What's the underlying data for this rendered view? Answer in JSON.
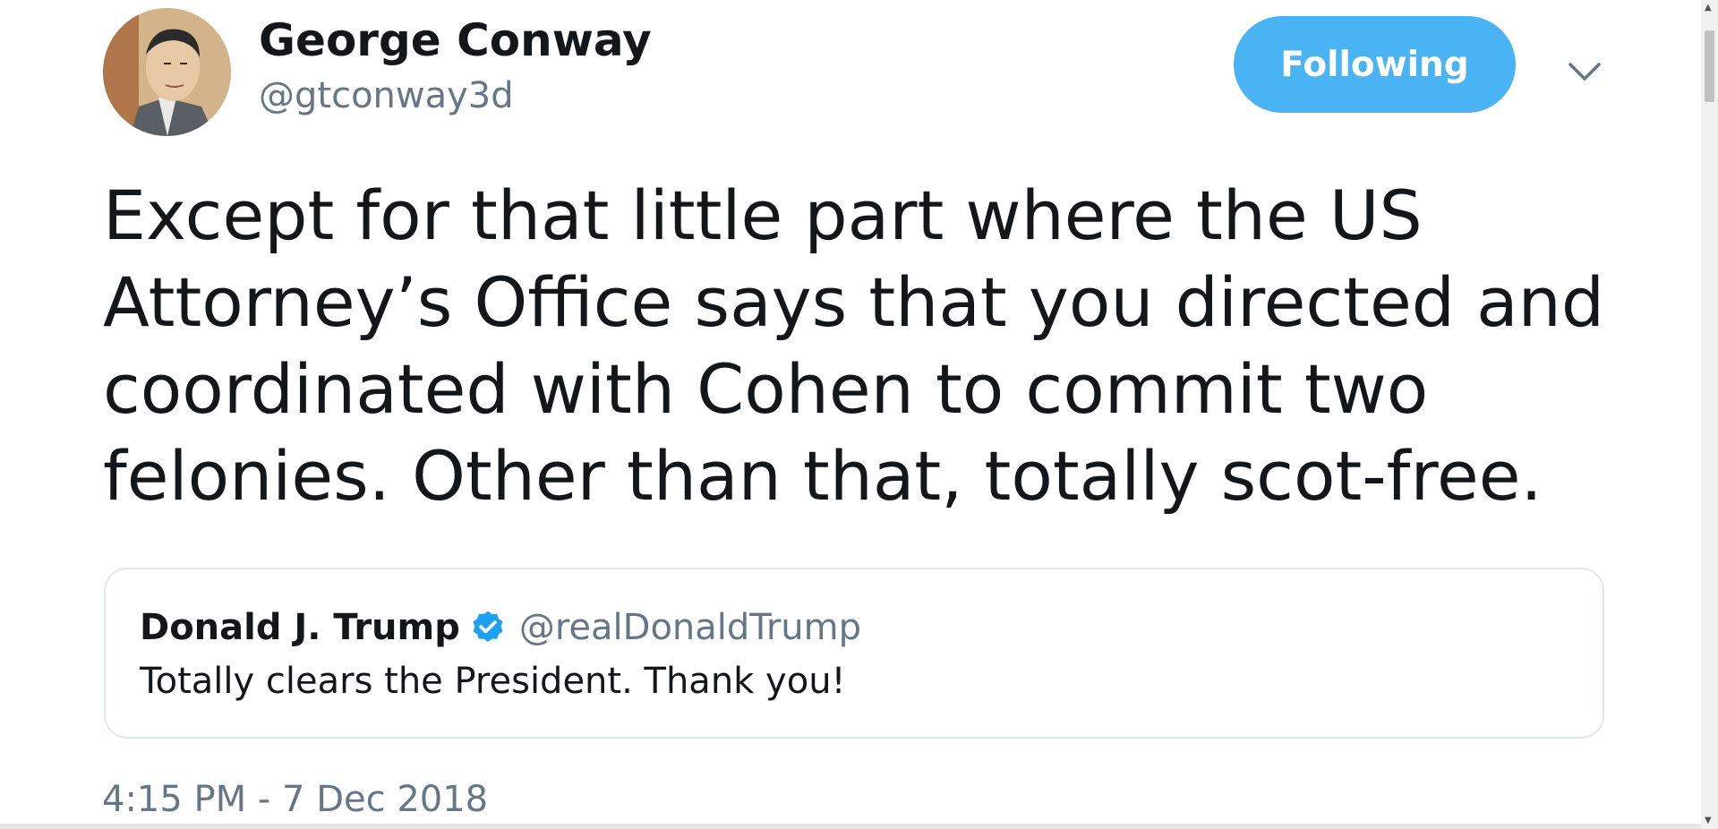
{
  "author": {
    "display_name": "George Conway",
    "handle": "@gtconway3d",
    "avatar_icon": "portrait-sketch-avatar"
  },
  "actions": {
    "follow_label": "Following",
    "more_icon": "chevron-down-icon"
  },
  "tweet": {
    "lines": [
      "Except for that little part where the US",
      "Attorney’s Office says that you directed and",
      "coordinated with Cohen to commit two",
      "felonies. Other than that, totally scot-free."
    ]
  },
  "quoted_tweet": {
    "display_name": "Donald J. Trump",
    "handle": "@realDonaldTrump",
    "verified_icon": "verified-badge-icon",
    "text": "Totally clears the President. Thank you!"
  },
  "timestamp": "4:15 PM - 7 Dec 2018",
  "colors": {
    "accent": "#4ab3f4",
    "verified": "#1da1f2",
    "text_primary": "#14171a",
    "text_secondary": "#657786",
    "border": "#e1e8ed"
  }
}
